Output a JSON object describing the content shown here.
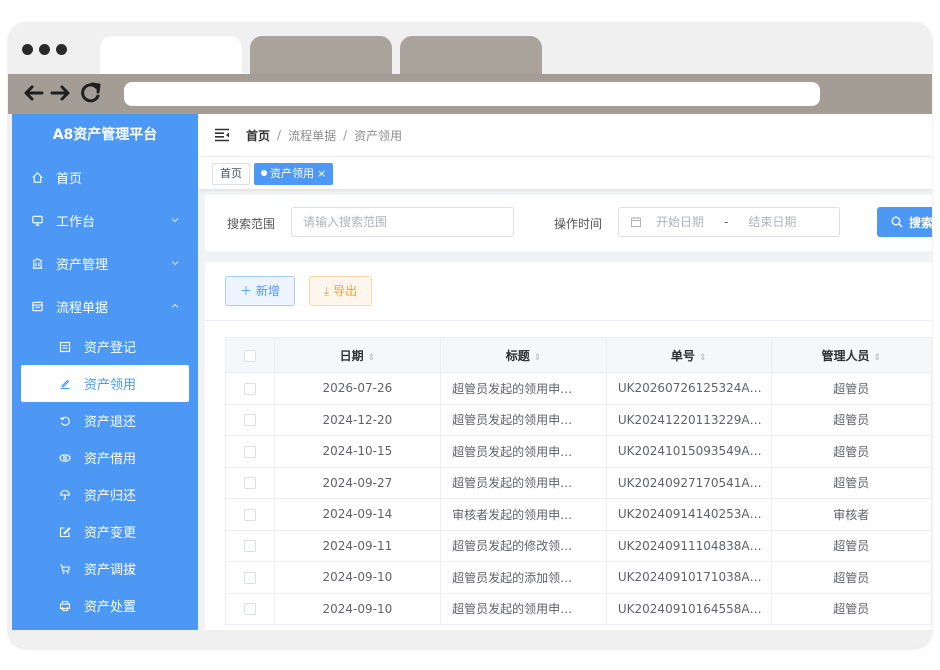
{
  "app": {
    "title": "A8资产管理平台",
    "colors": {
      "primary": "#4d98f5",
      "warning": "#e6a23c"
    }
  },
  "sidebar": {
    "items": [
      {
        "label": "首页",
        "icon": "home-icon"
      },
      {
        "label": "工作台",
        "icon": "monitor-icon",
        "expandable": true,
        "expanded": false
      },
      {
        "label": "资产管理",
        "icon": "building-icon",
        "expandable": true,
        "expanded": false
      },
      {
        "label": "流程单据",
        "icon": "document-icon",
        "expandable": true,
        "expanded": true
      }
    ],
    "subitems": [
      {
        "label": "资产登记",
        "icon": "register-icon"
      },
      {
        "label": "资产领用",
        "icon": "edit-icon",
        "active": true
      },
      {
        "label": "资产退还",
        "icon": "return-icon"
      },
      {
        "label": "资产借用",
        "icon": "eye-icon"
      },
      {
        "label": "资产归还",
        "icon": "umbrella-icon"
      },
      {
        "label": "资产变更",
        "icon": "edit-box-icon"
      },
      {
        "label": "资产调拔",
        "icon": "cart-icon"
      },
      {
        "label": "资产处置",
        "icon": "printer-icon"
      }
    ]
  },
  "breadcrumb": {
    "home": "首页",
    "sep": "/",
    "items": [
      "流程单据",
      "资产领用"
    ]
  },
  "tags": [
    {
      "label": "首页",
      "active": false
    },
    {
      "label": "资产领用",
      "active": true,
      "close": "×"
    }
  ],
  "search": {
    "range_label": "搜索范围",
    "range_placeholder": "请输入搜索范围",
    "time_label": "操作时间",
    "start_placeholder": "开始日期",
    "range_sep": "-",
    "end_placeholder": "结束日期",
    "search_button": "搜索"
  },
  "actions": {
    "add": "新增",
    "export": "导出"
  },
  "table": {
    "columns": [
      "日期",
      "标题",
      "单号",
      "管理人员"
    ],
    "rows": [
      [
        "2026-07-26",
        "超管员发起的领用申…",
        "UK20260726125324A…",
        "超管员"
      ],
      [
        "2024-12-20",
        "超管员发起的领用申…",
        "UK20241220113229A…",
        "超管员"
      ],
      [
        "2024-10-15",
        "超管员发起的领用申…",
        "UK20241015093549A…",
        "超管员"
      ],
      [
        "2024-09-27",
        "超管员发起的领用申…",
        "UK20240927170541A…",
        "超管员"
      ],
      [
        "2024-09-14",
        "审核者发起的领用申…",
        "UK20240914140253A…",
        "审核者"
      ],
      [
        "2024-09-11",
        "超管员发起的修改领…",
        "UK20240911104838A…",
        "超管员"
      ],
      [
        "2024-09-10",
        "超管员发起的添加领…",
        "UK20240910171038A…",
        "超管员"
      ],
      [
        "2024-09-10",
        "超管员发起的领用申…",
        "UK20240910164558A…",
        "超管员"
      ]
    ]
  }
}
